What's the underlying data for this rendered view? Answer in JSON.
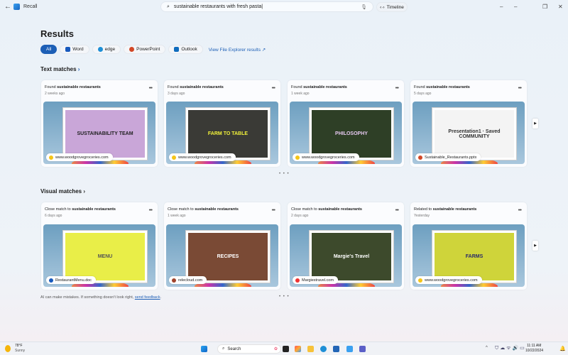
{
  "app": {
    "title": "Recall",
    "back_icon": "arrow-left-icon"
  },
  "search": {
    "value": "sustainable restaurants with fresh pasta|",
    "icon": "search-icon",
    "mic_icon": "microphone-icon"
  },
  "timeline": {
    "label": "Timeline"
  },
  "window": {
    "minimize": "–",
    "restore": "❐",
    "close": "✕"
  },
  "results": {
    "title": "Results"
  },
  "filters": [
    {
      "label": "All",
      "active": true
    },
    {
      "label": "Word",
      "color": "#185abd"
    },
    {
      "label": "edge",
      "color": "#1e8fd6"
    },
    {
      "label": "PowerPoint",
      "color": "#d24726"
    },
    {
      "label": "Outlook",
      "color": "#0f6cbd"
    }
  ],
  "file_explorer_link": "View File Explorer results ↗",
  "text_matches": {
    "title": "Text matches",
    "cards": [
      {
        "prefix": "Found ",
        "term": "sustainable restaurants",
        "date": "2 weeks ago",
        "slide": "SUSTAINABILITY TEAM",
        "slide_bg": "#c9a6d8",
        "slide_fg": "#222",
        "source": "www.woodgrovegroceries.com",
        "source_color": "#f5c518"
      },
      {
        "prefix": "Found ",
        "term": "sustainable restaurants",
        "date": "3 days ago",
        "slide": "FARM TO TABLE",
        "slide_bg": "#3a3a36",
        "slide_fg": "#f2f23a",
        "source": "www.woodgrovegroceries.com",
        "source_color": "#f5c518"
      },
      {
        "prefix": "Found ",
        "term": "sustainable restaurants",
        "date": "1 week ago",
        "slide": "PHILOSOPHY",
        "slide_bg": "#2e3f26",
        "slide_fg": "#e6c8f0",
        "source": "www.woodgrovegroceries.com",
        "source_color": "#f5c518"
      },
      {
        "prefix": "Found ",
        "term": "sustainable restaurants",
        "date": "5 days ago",
        "slide": "Presentation1 · Saved  COMMUNITY",
        "slide_bg": "#f4f4f4",
        "slide_fg": "#333",
        "source": "Sustainable_Restaurants.pptx",
        "source_color": "#d24726"
      }
    ]
  },
  "visual_matches": {
    "title": "Visual matches",
    "cards": [
      {
        "prefix": "Close match to ",
        "term": "sustainable restaurants",
        "date": "6 days ago",
        "slide": "MENU",
        "slide_bg": "#e9ee48",
        "slide_fg": "#555",
        "source": "RestaurantMenu.doc",
        "source_color": "#185abd"
      },
      {
        "prefix": "Close match to ",
        "term": "sustainable restaurants",
        "date": "1 week ago",
        "slide": "RECIPES",
        "slide_bg": "#7a4a35",
        "slide_fg": "#fff",
        "source": "relecloud.com",
        "source_color": "#a0442c"
      },
      {
        "prefix": "Close match to ",
        "term": "sustainable restaurants",
        "date": "2 days ago",
        "slide": "Margie's Travel",
        "slide_bg": "#3d4a2c",
        "slide_fg": "#fff",
        "source": "Margiestravel.com",
        "source_color": "#e33"
      },
      {
        "prefix": "Related to ",
        "term": "sustainable restaurants",
        "date": "Yesterday",
        "slide": "FARMS",
        "slide_bg": "#cfd43a",
        "slide_fg": "#2a2a6a",
        "source": "www.woodgrovegroceries.com",
        "source_color": "#f5c518"
      }
    ]
  },
  "disclaimer": {
    "text": "AI can make mistakes. If something doesn't look right, ",
    "link": "send feedback",
    "end": "."
  },
  "pager_dots": "• • •",
  "next_icon": "chevron-right-icon",
  "taskbar": {
    "weather_temp": "78°F",
    "weather_desc": "Sunny",
    "search_placeholder": "Search",
    "time": "11:11 AM",
    "date": "10/22/2024"
  }
}
